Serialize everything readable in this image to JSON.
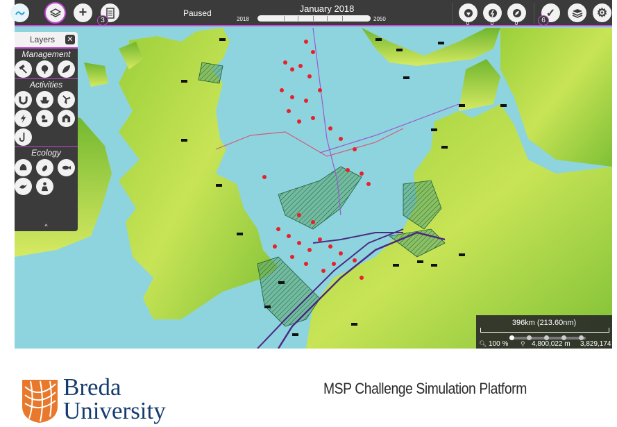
{
  "topbar": {
    "status": "Paused",
    "date": "January 2018",
    "year_start": "2018",
    "year_end": "2050",
    "plans_badge": "3",
    "approve_badge": "6",
    "counts": [
      "0",
      "0",
      "0"
    ],
    "accent": "#c64bd8",
    "icons": [
      "sea-logo-icon",
      "layers-icon",
      "plus-icon",
      "list-icon",
      "energy-issues-icon",
      "shipping-issues-icon",
      "ecology-issues-icon",
      "checkmark-icon",
      "stacked-layers-icon",
      "gear-icon"
    ]
  },
  "layers_panel": {
    "title": "Layers",
    "categories": [
      {
        "label": "Management",
        "icons": [
          "gavel-icon",
          "tree-icon",
          "leaf-icon"
        ]
      },
      {
        "label": "Activities",
        "icons": [
          "magnet-icon",
          "ship-icon",
          "wind-turbine-icon",
          "lightning-icon",
          "diver-icon",
          "bunker-icon",
          "fishing-hook-icon"
        ]
      },
      {
        "label": "Ecology",
        "icons": [
          "shell-icon",
          "footprint-icon",
          "fish-icon",
          "bird-icon",
          "people-icon"
        ]
      }
    ]
  },
  "scale": {
    "label": "396km (213.60nm)",
    "zoom": "100 %",
    "x": "4,800,022 m",
    "y": "3,829,174"
  },
  "footer": {
    "university_line1": "Breda",
    "university_line2": "University",
    "platform": "MSP Challenge Simulation Platform",
    "brand_color": "#143c6e",
    "logo_color": "#e8792c"
  }
}
